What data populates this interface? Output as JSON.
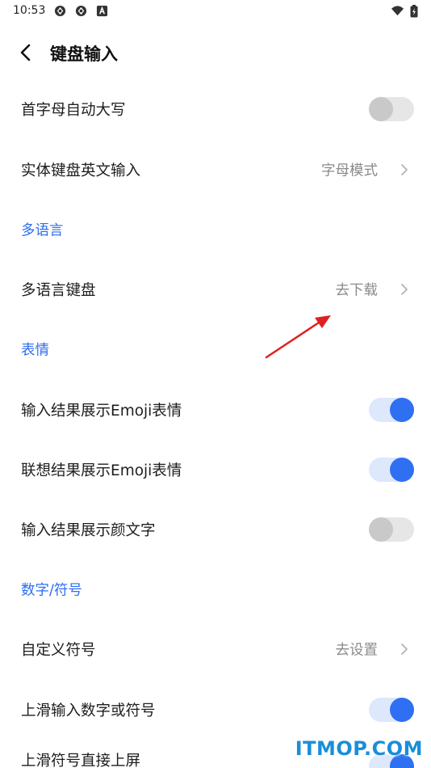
{
  "status_bar": {
    "time": "10:53",
    "icons": [
      "sync-icon",
      "sync-icon",
      "notification-icon",
      "wifi-icon",
      "battery-icon"
    ]
  },
  "header": {
    "title": "键盘输入",
    "back_icon": "chevron-left-icon"
  },
  "rows": [
    {
      "kind": "toggle",
      "label": "首字母自动大写",
      "on": false
    },
    {
      "kind": "link",
      "label": "实体键盘英文输入",
      "value": "字母模式"
    },
    {
      "kind": "section",
      "label": "多语言"
    },
    {
      "kind": "link",
      "label": "多语言键盘",
      "value": "去下载"
    },
    {
      "kind": "section",
      "label": "表情"
    },
    {
      "kind": "toggle",
      "label": "输入结果展示Emoji表情",
      "on": true
    },
    {
      "kind": "toggle",
      "label": "联想结果展示Emoji表情",
      "on": true
    },
    {
      "kind": "toggle",
      "label": "输入结果展示颜文字",
      "on": false
    },
    {
      "kind": "section",
      "label": "数字/符号"
    },
    {
      "kind": "link",
      "label": "自定义符号",
      "value": "去设置"
    },
    {
      "kind": "toggle",
      "label": "上滑输入数字或符号",
      "on": true
    },
    {
      "kind": "toggle",
      "label": "上滑符号直接上屏",
      "on": true
    }
  ],
  "annotation": {
    "icon": "red-arrow-icon",
    "color": "#e02020"
  },
  "watermark": "ITMOP.COM",
  "colors": {
    "accent": "#2f6ff2",
    "section": "#2e6ef0",
    "toggle_off_track": "#e6e6e6",
    "toggle_off_knob": "#c9c9c9",
    "toggle_on_track": "#dde8fd",
    "value_text": "#8a8a8a",
    "watermark": "#1a8ed8"
  }
}
